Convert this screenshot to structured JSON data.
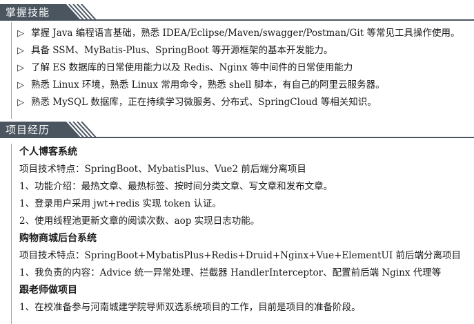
{
  "skills_section": {
    "title": "掌握技能",
    "items": [
      "掌握 Java 编程语言基础，熟悉 IDEA/Eclipse/Maven/swagger/Postman/Git 等常见工具操作使用。",
      "具备 SSM、MyBatis-Plus、SpringBoot 等开源框架的基本开发能力。",
      "了解 ES 数据库的日常使用能力以及 Redis、Nginx 等中间件的日常使用能力",
      "熟悉 Linux 环境，熟悉 Linux 常用命令，熟悉 shell 脚本，有自己的阿里云服务器。",
      "熟悉 MySQL 数据库，正在持续学习微服务、分布式、SpringCloud 等相关知识。"
    ]
  },
  "projects_section": {
    "title": "项目经历",
    "projects": [
      {
        "name": "个人博客系统",
        "lines": [
          "项目技术特点：SpringBoot、MybatisPlus、Vue2 前后端分离项目",
          "1、功能介绍：最热文章、最热标签、按时间分类文章、写文章和发布文章。",
          "1、登录用户采用 jwt+redis 实现 token 认证。",
          "2、使用线程池更新文章的阅读次数、aop 实现日志功能。"
        ]
      },
      {
        "name": "购物商城后台系统",
        "lines": [
          "项目技术特点：SpringBoot+MybatisPlus+Redis+Druid+Nginx+Vue+ElementUI 前后端分离项目",
          "1、我负责的内容：Advice 统一异常处理、拦截器 HandlerInterceptor、配置前后端 Nginx 代理等"
        ]
      },
      {
        "name": "跟老师做项目",
        "lines": [
          "1、在校准备参与河南城建学院导师双选系统项目的工作，目前是项目的准备阶段。"
        ]
      }
    ]
  },
  "colors": {
    "header_fill": "#4a5560",
    "header_line": "#4a5560",
    "body_border": "#9fa6ad"
  },
  "icons": {
    "bullet": "triangle-right-outline-icon"
  }
}
